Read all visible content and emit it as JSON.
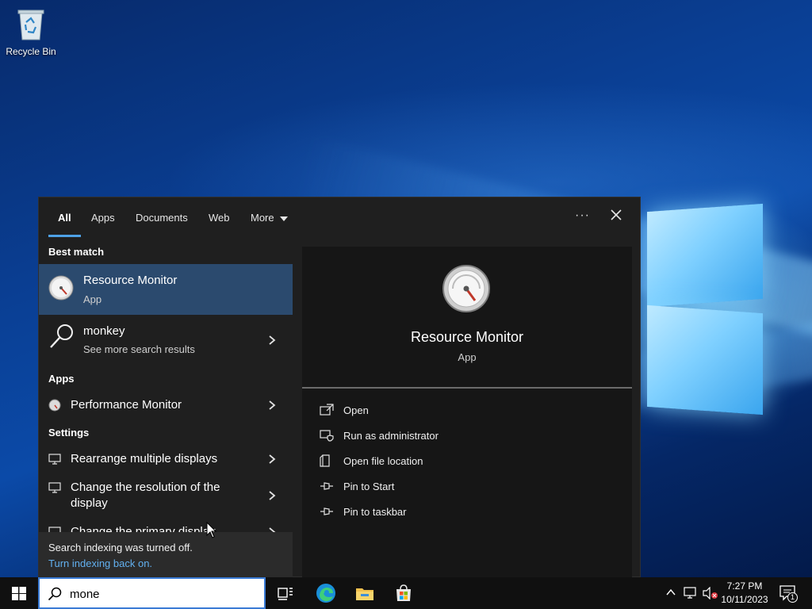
{
  "desktop": {
    "recycle_bin_label": "Recycle Bin"
  },
  "search_panel": {
    "tabs": [
      {
        "label": "All",
        "active": true
      },
      {
        "label": "Apps",
        "active": false
      },
      {
        "label": "Documents",
        "active": false
      },
      {
        "label": "Web",
        "active": false
      },
      {
        "label": "More",
        "active": false
      }
    ],
    "more_options_label": "···",
    "sections": {
      "best_match": "Best match",
      "apps": "Apps",
      "settings": "Settings"
    },
    "best_match": {
      "title": "Resource Monitor",
      "subtitle": "App"
    },
    "web_result": {
      "title": "monkey",
      "subtitle": "See more search results"
    },
    "apps": [
      {
        "title": "Performance Monitor"
      }
    ],
    "settings": [
      {
        "title": "Rearrange multiple displays"
      },
      {
        "title_line1": "Change the resolution of the",
        "title_line2": "display"
      },
      {
        "title": "Change the primary display"
      }
    ],
    "index_notice": {
      "message": "Search indexing was turned off.",
      "link": "Turn indexing back on."
    },
    "preview": {
      "title": "Resource Monitor",
      "subtitle": "App",
      "actions": [
        {
          "label": "Open",
          "icon": "open-icon"
        },
        {
          "label": "Run as administrator",
          "icon": "shield-icon"
        },
        {
          "label": "Open file location",
          "icon": "file-location-icon"
        },
        {
          "label": "Pin to Start",
          "icon": "pin-icon"
        },
        {
          "label": "Pin to taskbar",
          "icon": "pin-icon"
        }
      ]
    }
  },
  "taskbar": {
    "search_value": "mone",
    "time": "7:27 PM",
    "date": "10/11/2023",
    "notification_count": "1"
  },
  "colors": {
    "accent": "#4ea1e6",
    "selected_row": "#2b4a6e",
    "panel_bg": "#1f1f1f",
    "link": "#62b0ef"
  }
}
